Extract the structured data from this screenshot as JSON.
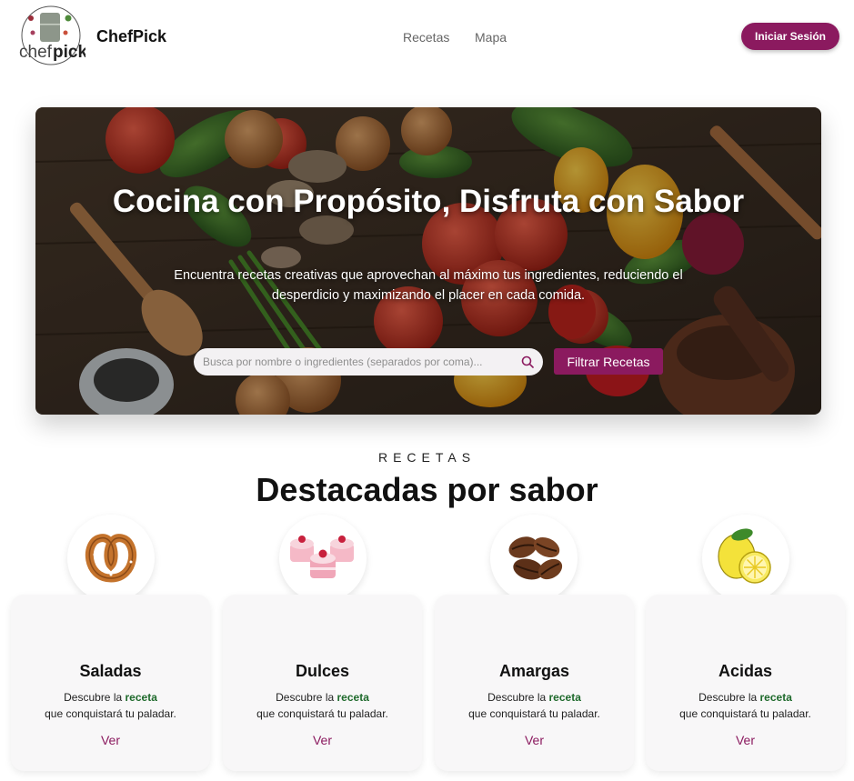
{
  "navbar": {
    "brand": "ChefPick",
    "logo_text_a": "chef",
    "logo_text_b": "pick",
    "links": [
      {
        "label": "Recetas"
      },
      {
        "label": "Mapa"
      }
    ],
    "login_label": "Iniciar Sesión",
    "accent_color": "#8b1a5f"
  },
  "hero": {
    "title": "Cocina con Propósito, Disfruta con Sabor",
    "subtitle": "Encuentra recetas creativas que aprovechan al máximo tus ingredientes, reduciendo el desperdicio y maximizando el placer en cada comida.",
    "search_placeholder": "Busca por nombre o ingredientes (separados por coma)...",
    "search_icon": "search-icon",
    "filter_label": "Filtrar Recetas"
  },
  "section": {
    "kicker": "RECETAS",
    "title": "Destacadas por sabor"
  },
  "cards": [
    {
      "title": "Saladas",
      "desc_prefix": "Descubre la ",
      "desc_highlight": "receta",
      "desc_line2": "que conquistará tu paladar.",
      "link": "Ver",
      "icon": "pretzel-icon"
    },
    {
      "title": "Dulces",
      "desc_prefix": "Descubre la ",
      "desc_highlight": "receta",
      "desc_line2": "que conquistará tu paladar.",
      "link": "Ver",
      "icon": "cupcakes-icon"
    },
    {
      "title": "Amargas",
      "desc_prefix": "Descubre la ",
      "desc_highlight": "receta",
      "desc_line2": "que conquistará tu paladar.",
      "link": "Ver",
      "icon": "coffee-beans-icon"
    },
    {
      "title": "Acidas",
      "desc_prefix": "Descubre la ",
      "desc_highlight": "receta",
      "desc_line2": "que conquistará tu paladar.",
      "link": "Ver",
      "icon": "lemon-icon"
    }
  ]
}
